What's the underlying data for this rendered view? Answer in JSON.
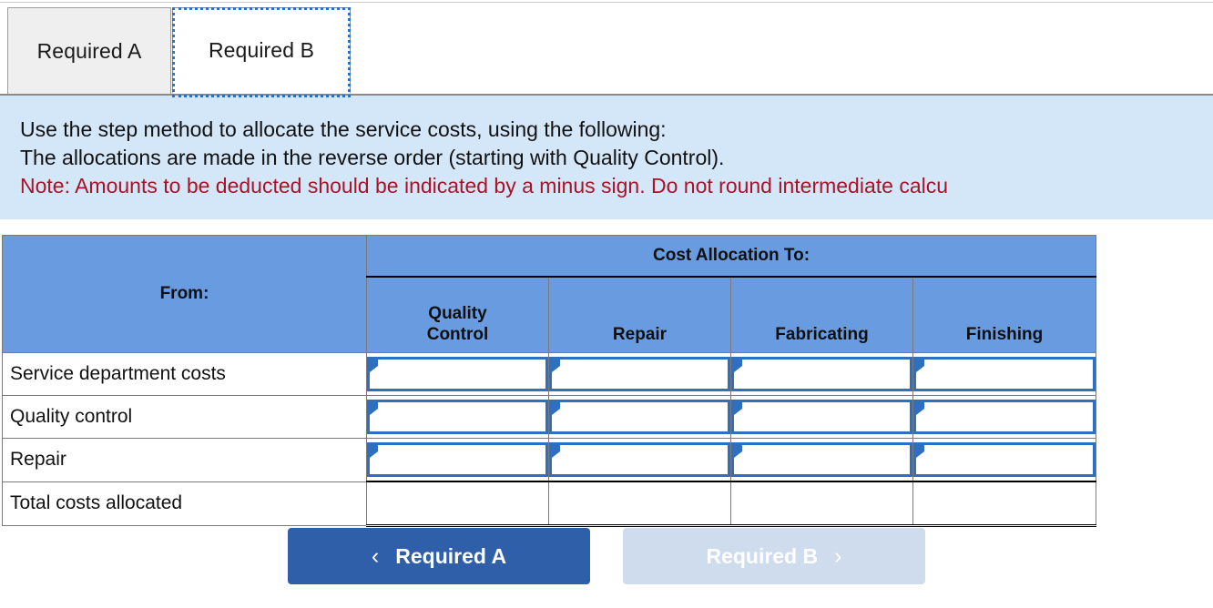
{
  "tabs": [
    {
      "label": "Required A",
      "active": false
    },
    {
      "label": "Required B",
      "active": true
    }
  ],
  "instructions": {
    "line1": "Use the step method to allocate the service costs, using the following:",
    "line2": "The allocations are made in the reverse order (starting with Quality Control).",
    "note": "Note: Amounts to be deducted should be indicated by a minus sign. Do not round intermediate calcu"
  },
  "table": {
    "group_header": "Cost Allocation To:",
    "from_header": "From:",
    "columns": [
      "Quality\nControl",
      "Repair",
      "Fabricating",
      "Finishing"
    ],
    "col_quality_control_line1": "Quality",
    "col_quality_control_line2": "Control",
    "col_repair": "Repair",
    "col_fabricating": "Fabricating",
    "col_finishing": "Finishing",
    "rows": [
      {
        "label": "Service department costs",
        "type": "input",
        "values": [
          "",
          "",
          "",
          ""
        ]
      },
      {
        "label": "Quality control",
        "type": "input",
        "values": [
          "",
          "",
          "",
          ""
        ]
      },
      {
        "label": "Repair",
        "type": "input",
        "values": [
          "",
          "",
          "",
          ""
        ]
      },
      {
        "label": "Total costs allocated",
        "type": "total",
        "values": [
          "",
          "",
          "",
          ""
        ]
      }
    ]
  },
  "footer": {
    "prev_label": "Required A",
    "prev_icon": "chevron-left-icon",
    "prev_chevron": "‹",
    "next_label": "Required B",
    "next_icon": "chevron-right-icon",
    "next_chevron": "›",
    "next_disabled": true
  },
  "colors": {
    "header_blue": "#689be0",
    "panel_blue": "#d4e7f9",
    "note_red": "#a81427",
    "input_border_blue": "#2f6fc0",
    "btn_primary": "#2e5fa8",
    "btn_disabled": "#cedcee"
  }
}
